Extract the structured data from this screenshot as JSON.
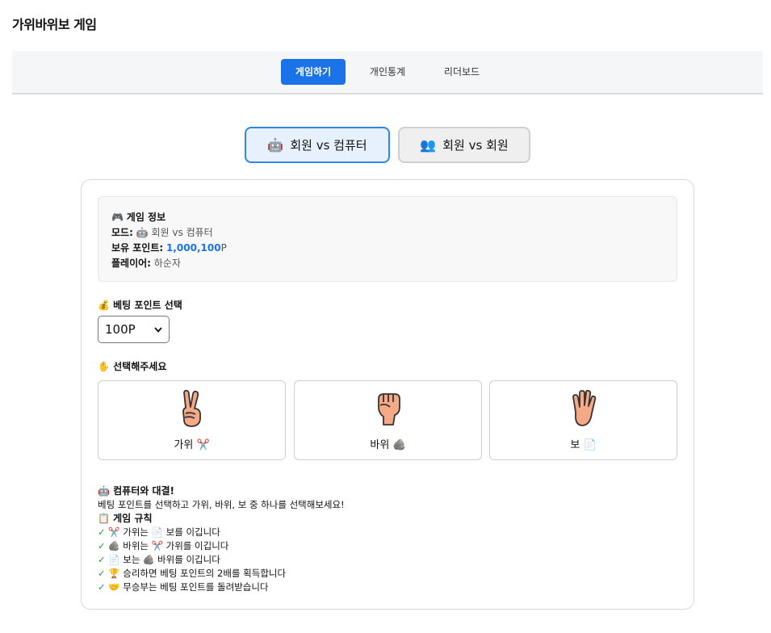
{
  "app": {
    "title": "가위바위보 게임"
  },
  "nav": {
    "tabs": [
      "게임하기",
      "개인통계",
      "리더보드"
    ],
    "active": "게임하기"
  },
  "modes": [
    {
      "icon": "🤖",
      "label": "회원 vs 컴퓨터",
      "active": true
    },
    {
      "icon": "👥",
      "label": "회원 vs 회원",
      "active": false
    }
  ],
  "info": {
    "heading_icon": "🎮",
    "heading": "게임 정보",
    "mode_label": "모드:",
    "mode_icon": "🤖",
    "mode_value": "회원 vs 컴퓨터",
    "points_label": "보유 포인트:",
    "points_value": "1,000,100",
    "points_unit": "P",
    "player_label": "플레이어:",
    "player_value": "하순자"
  },
  "bet": {
    "icon": "💰",
    "label": "베팅 포인트 선택",
    "selected": "100P"
  },
  "choice_prompt": {
    "icon": "✋",
    "label": "선택해주세요"
  },
  "choices": [
    {
      "label": "가위",
      "icon": "✂️",
      "hand": "scissors-hand-icon"
    },
    {
      "label": "바위",
      "icon": "🪨",
      "hand": "rock-hand-icon"
    },
    {
      "label": "보",
      "icon": "📄",
      "hand": "paper-hand-icon"
    }
  ],
  "guide": {
    "title_icon": "🤖",
    "title": "컴퓨터와 대결!",
    "desc": "베팅 포인트를 선택하고 가위, 바위, 보 중 하나를 선택해보세요!",
    "rules_icon": "📋",
    "rules_title": "게임 규칙",
    "check": "✓",
    "rules": [
      "✂️ 가위는 📄 보를 이깁니다",
      "🪨 바위는 ✂️ 가위를 이깁니다",
      "📄 보는 🪨 바위를 이깁니다",
      "🏆 승리하면 베팅 포인트의 2배를 획득합니다",
      "🤝 무승부는 베팅 포인트를 돌려받습니다"
    ]
  },
  "colors": {
    "accent": "#1a73e8",
    "active_mode_bg": "#e7f1fd",
    "active_mode_border": "#2f86e8",
    "check": "#22a046",
    "skin": "#f5a987"
  }
}
